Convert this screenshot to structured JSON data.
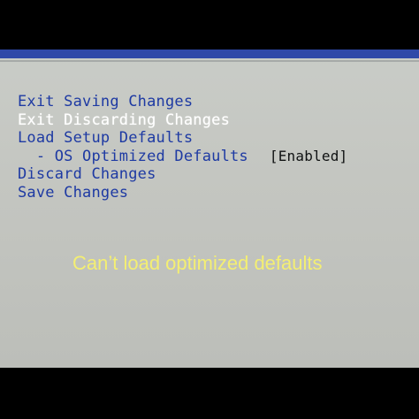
{
  "menu": {
    "items": [
      {
        "label": "Exit Saving Changes",
        "value": ""
      },
      {
        "label": "Exit Discarding Changes",
        "value": ""
      },
      {
        "label": "Load Setup Defaults",
        "value": ""
      },
      {
        "label": "  - OS Optimized Defaults",
        "value": "[Enabled]"
      },
      {
        "label": "Discard Changes",
        "value": ""
      },
      {
        "label": "Save Changes",
        "value": ""
      }
    ]
  },
  "caption": {
    "text": "Can’t load optimized defaults"
  }
}
